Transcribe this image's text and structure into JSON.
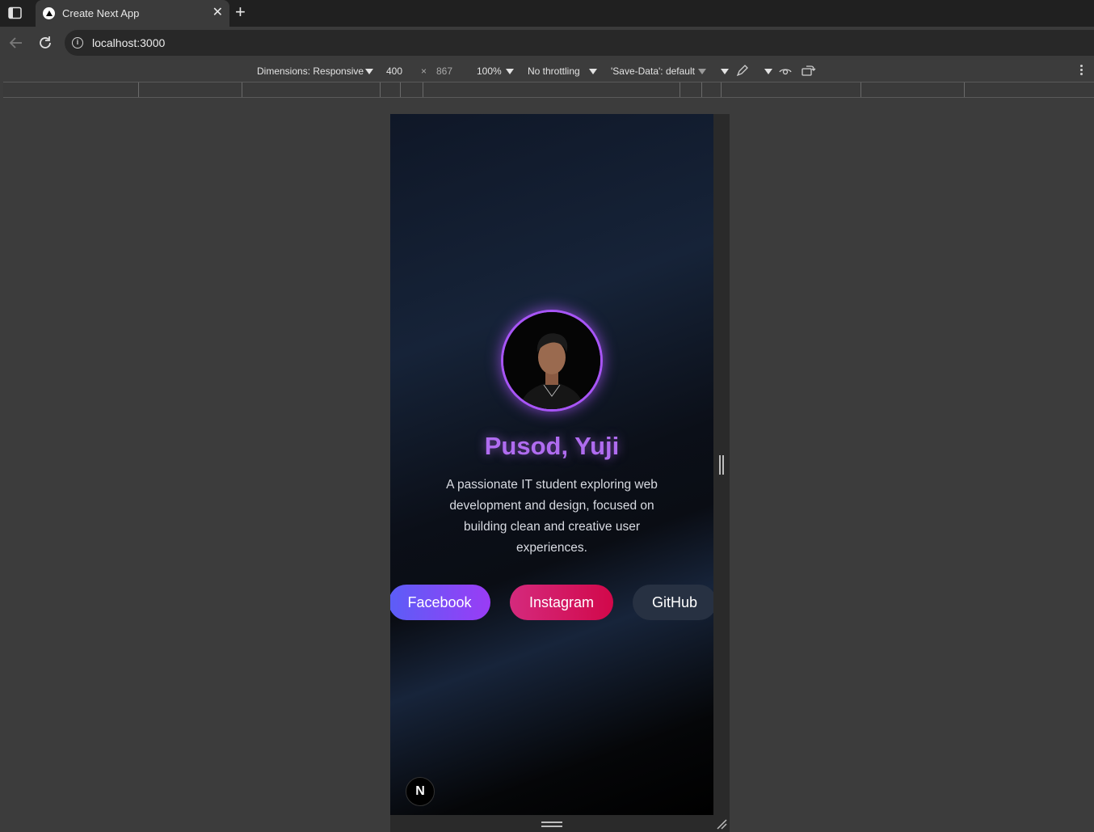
{
  "browser": {
    "tab_title": "Create Next App",
    "tab_close": "✕",
    "new_tab": "+",
    "url": "localhost:3000",
    "info_glyph": "i"
  },
  "devtools": {
    "dimensions_label": "Dimensions: Responsive",
    "width": "400",
    "times": "×",
    "height": "867",
    "zoom": "100%",
    "throttling": "No throttling",
    "save_data": "'Save-Data': default"
  },
  "profile": {
    "name": "Pusod, Yuji",
    "bio": "A passionate IT student exploring web development and design, focused on building clean and creative user experiences.",
    "buttons": {
      "facebook": "Facebook",
      "instagram": "Instagram",
      "github": "GitHub"
    },
    "next_badge": "N"
  },
  "colors": {
    "accent_purple": "#a855f7",
    "facebook_gradient": [
      "#5b5ef7",
      "#9a3cf5"
    ],
    "instagram_gradient": [
      "#d42a7d",
      "#d2084a"
    ],
    "github_bg": "#273142"
  }
}
